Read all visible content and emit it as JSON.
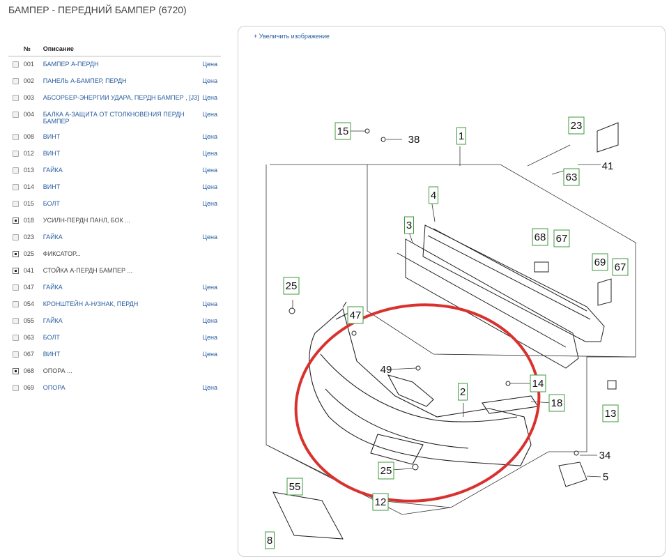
{
  "page": {
    "title": "БАМПЕР - ПЕРЕДНИЙ БАМПЕР (6720)"
  },
  "table": {
    "col_number": "№",
    "col_description": "Описание",
    "rows": [
      {
        "number": "001",
        "description": "БАМПЕР А-ПЕРДН",
        "price": "Цена",
        "control": "checkbox",
        "link": true
      },
      {
        "number": "002",
        "description": "ПАНЕЛЬ А-БАМПЕР, ПЕРДН",
        "price": "Цена",
        "control": "checkbox",
        "link": true
      },
      {
        "number": "003",
        "description": "АБСОРБЕР-ЭНЕРГИИ УДАРА, ПЕРДН БАМПЕР , [J3]",
        "price": "Цена",
        "control": "checkbox",
        "link": true
      },
      {
        "number": "004",
        "description": "БАЛКА А-ЗАЩИТА ОТ СТОЛКНОВЕНИЯ ПЕРДН БАМПЕР",
        "price": "Цена",
        "control": "checkbox",
        "link": true
      },
      {
        "number": "008",
        "description": "ВИНТ",
        "price": "Цена",
        "control": "checkbox",
        "link": true
      },
      {
        "number": "012",
        "description": "ВИНТ",
        "price": "Цена",
        "control": "checkbox",
        "link": true
      },
      {
        "number": "013",
        "description": "ГАЙКА",
        "price": "Цена",
        "control": "checkbox",
        "link": true
      },
      {
        "number": "014",
        "description": "ВИНТ",
        "price": "Цена",
        "control": "checkbox",
        "link": true
      },
      {
        "number": "015",
        "description": "БОЛТ",
        "price": "Цена",
        "control": "checkbox",
        "link": true
      },
      {
        "number": "018",
        "description": "УСИЛН-ПЕРДН ПАНЛ, БОК ...",
        "price": "",
        "control": "expand",
        "link": false
      },
      {
        "number": "023",
        "description": "ГАЙКА",
        "price": "Цена",
        "control": "checkbox",
        "link": true
      },
      {
        "number": "025",
        "description": "ФИКСАТОР...",
        "price": "",
        "control": "expand",
        "link": false
      },
      {
        "number": "041",
        "description": "СТОЙКА А-ПЕРДН БАМПЕР ...",
        "price": "",
        "control": "expand",
        "link": false
      },
      {
        "number": "047",
        "description": "ГАЙКА",
        "price": "Цена",
        "control": "checkbox",
        "link": true
      },
      {
        "number": "054",
        "description": "КРОНШТЕЙН А-Н/ЗНАК, ПЕРДН",
        "price": "Цена",
        "control": "checkbox",
        "link": true
      },
      {
        "number": "055",
        "description": "ГАЙКА",
        "price": "Цена",
        "control": "checkbox",
        "link": true
      },
      {
        "number": "063",
        "description": "БОЛТ",
        "price": "Цена",
        "control": "checkbox",
        "link": true
      },
      {
        "number": "067",
        "description": "ВИНТ",
        "price": "Цена",
        "control": "checkbox",
        "link": true
      },
      {
        "number": "068",
        "description": "ОПОРА ...",
        "price": "",
        "control": "expand",
        "link": false
      },
      {
        "number": "069",
        "description": "ОПОРА",
        "price": "Цена",
        "control": "checkbox",
        "link": true
      }
    ]
  },
  "image_panel": {
    "zoom_label": "+ Увеличить изображение"
  },
  "diagram": {
    "callouts": [
      {
        "label": "15",
        "boxed": true
      },
      {
        "label": "38",
        "boxed": false
      },
      {
        "label": "1",
        "boxed": true
      },
      {
        "label": "23",
        "boxed": true
      },
      {
        "label": "41",
        "boxed": false
      },
      {
        "label": "63",
        "boxed": true
      },
      {
        "label": "4",
        "boxed": true
      },
      {
        "label": "3",
        "boxed": true
      },
      {
        "label": "68",
        "boxed": true
      },
      {
        "label": "67",
        "boxed": true
      },
      {
        "label": "69",
        "boxed": true
      },
      {
        "label": "67",
        "boxed": true
      },
      {
        "label": "25",
        "boxed": true
      },
      {
        "label": "47",
        "boxed": true
      },
      {
        "label": "49",
        "boxed": false
      },
      {
        "label": "2",
        "boxed": true
      },
      {
        "label": "14",
        "boxed": true
      },
      {
        "label": "18",
        "boxed": true
      },
      {
        "label": "13",
        "boxed": true
      },
      {
        "label": "34",
        "boxed": false
      },
      {
        "label": "5",
        "boxed": false
      },
      {
        "label": "25",
        "boxed": true
      },
      {
        "label": "55",
        "boxed": true
      },
      {
        "label": "12",
        "boxed": true
      },
      {
        "label": "8",
        "boxed": true
      }
    ],
    "highlight_color": "#d9322e",
    "label_box_color": "#3c9a3c"
  }
}
